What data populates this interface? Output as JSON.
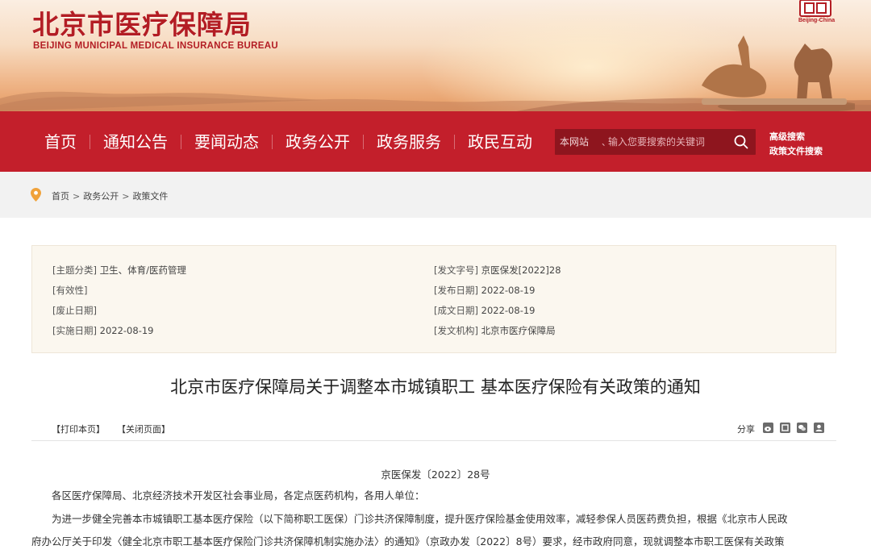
{
  "header": {
    "logo_cn": "北京市医疗保障局",
    "logo_en": "BEIJING MUNICIPAL MEDICAL INSURANCE BUREAU",
    "seal_text": "Beijing-China"
  },
  "nav": {
    "items": [
      "首页",
      "通知公告",
      "要闻动态",
      "政务公开",
      "政务服务",
      "政民互动"
    ],
    "search_scope": "本网站",
    "search_placeholder": "输入您要搜索的关键词",
    "advanced_search": "高级搜索",
    "policy_search": "政策文件搜索"
  },
  "breadcrumb": [
    "首页",
    "政务公开",
    "政策文件"
  ],
  "meta": {
    "left": [
      {
        "key": "[主题分类]",
        "value": "卫生、体育/医药管理"
      },
      {
        "key": "[有效性]",
        "value": ""
      },
      {
        "key": "[废止日期]",
        "value": ""
      },
      {
        "key": "[实施日期]",
        "value": "2022-08-19"
      }
    ],
    "right": [
      {
        "key": "[发文字号]",
        "value": "京医保发[2022]28"
      },
      {
        "key": "[发布日期]",
        "value": "2022-08-19"
      },
      {
        "key": "[成文日期]",
        "value": "2022-08-19"
      },
      {
        "key": "[发文机构]",
        "value": "北京市医疗保障局"
      }
    ]
  },
  "article": {
    "title": "北京市医疗保障局关于调整本市城镇职工 基本医疗保险有关政策的通知",
    "print_label": "【打印本页】",
    "close_label": "【关闭页面】",
    "share_label": "分享",
    "doc_no": "京医保发〔2022〕28号",
    "para1": "各区医疗保障局、北京经济技术开发区社会事业局，各定点医药机构，各用人单位：",
    "para2_line1": "为进一步健全完善本市城镇职工基本医疗保险（以下简称职工医保）门诊共济保障制度，提升医疗保险基金使用效率，减轻参保人员医药费负担，根据《北京市人民政",
    "para2_line2": "府办公厅关于印发〈健全北京市职工基本医疗保险门诊共济保障机制实施办法〉的通知》（京政办发〔2022〕8号）要求，经市政府同意，现就调整本市职工医保有关政策"
  },
  "colors": {
    "brand_red": "#c31f2b",
    "logo_red": "#b31d24"
  }
}
